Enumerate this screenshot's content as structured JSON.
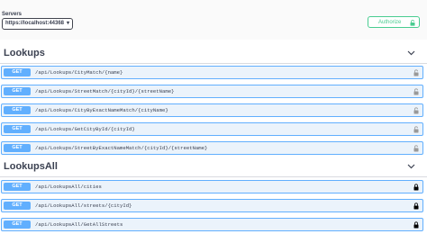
{
  "servers": {
    "label": "Servers",
    "selected": "https://localhost:44368"
  },
  "authorize": {
    "label": "Authorize"
  },
  "colors": {
    "get_method": "#61affe",
    "get_row_bg": "#ebf3fb",
    "authorize": "#49cc90",
    "text": "#3b4151"
  },
  "sections": [
    {
      "title": "Lookups",
      "operations": [
        {
          "method": "GET",
          "path": "/api/Lookups/CityMatch/{name}",
          "lock": "unlocked"
        },
        {
          "method": "GET",
          "path": "/api/Lookups/StreetMatch/{cityId}/{streetName}",
          "lock": "unlocked"
        },
        {
          "method": "GET",
          "path": "/api/Lookups/CityByExactNameMatch/{cityName}",
          "lock": "unlocked"
        },
        {
          "method": "GET",
          "path": "/api/Lookups/GetCityById/{cityId}",
          "lock": "unlocked"
        },
        {
          "method": "GET",
          "path": "/api/Lookups/StreetByExactNameMatch/{cityId}/{streetName}",
          "lock": "unlocked"
        }
      ]
    },
    {
      "title": "LookupsAll",
      "operations": [
        {
          "method": "GET",
          "path": "/api/LookupsAll/cities",
          "lock": "locked"
        },
        {
          "method": "GET",
          "path": "/api/LookupsAll/streets/{cityId}",
          "lock": "locked"
        },
        {
          "method": "GET",
          "path": "/api/LookupsAll/GetAllStreets",
          "lock": "locked"
        }
      ]
    }
  ]
}
